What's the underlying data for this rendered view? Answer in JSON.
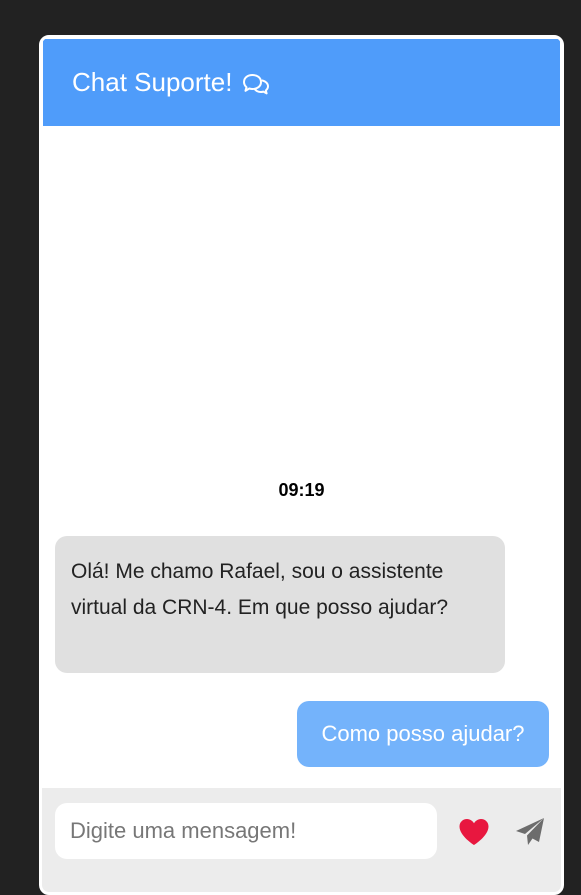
{
  "header": {
    "title": "Chat Suporte!",
    "icon": "chat-bubbles-icon"
  },
  "messages": {
    "timestamp": "09:19",
    "bot_message": "Olá! Me chamo Rafael, sou o assistente virtual da CRN-4. Em que posso ajudar?",
    "user_message": "Como posso ajudar?"
  },
  "input": {
    "placeholder": "Digite uma mensagem!",
    "value": ""
  },
  "actions": {
    "heart_icon": "heart-icon",
    "send_icon": "send-icon"
  },
  "colors": {
    "header_bg": "#4f9cfa",
    "user_bubble": "#74b3fb",
    "bot_bubble": "#e0e0e0",
    "heart": "#e8173f",
    "send": "#6c6c6c"
  }
}
